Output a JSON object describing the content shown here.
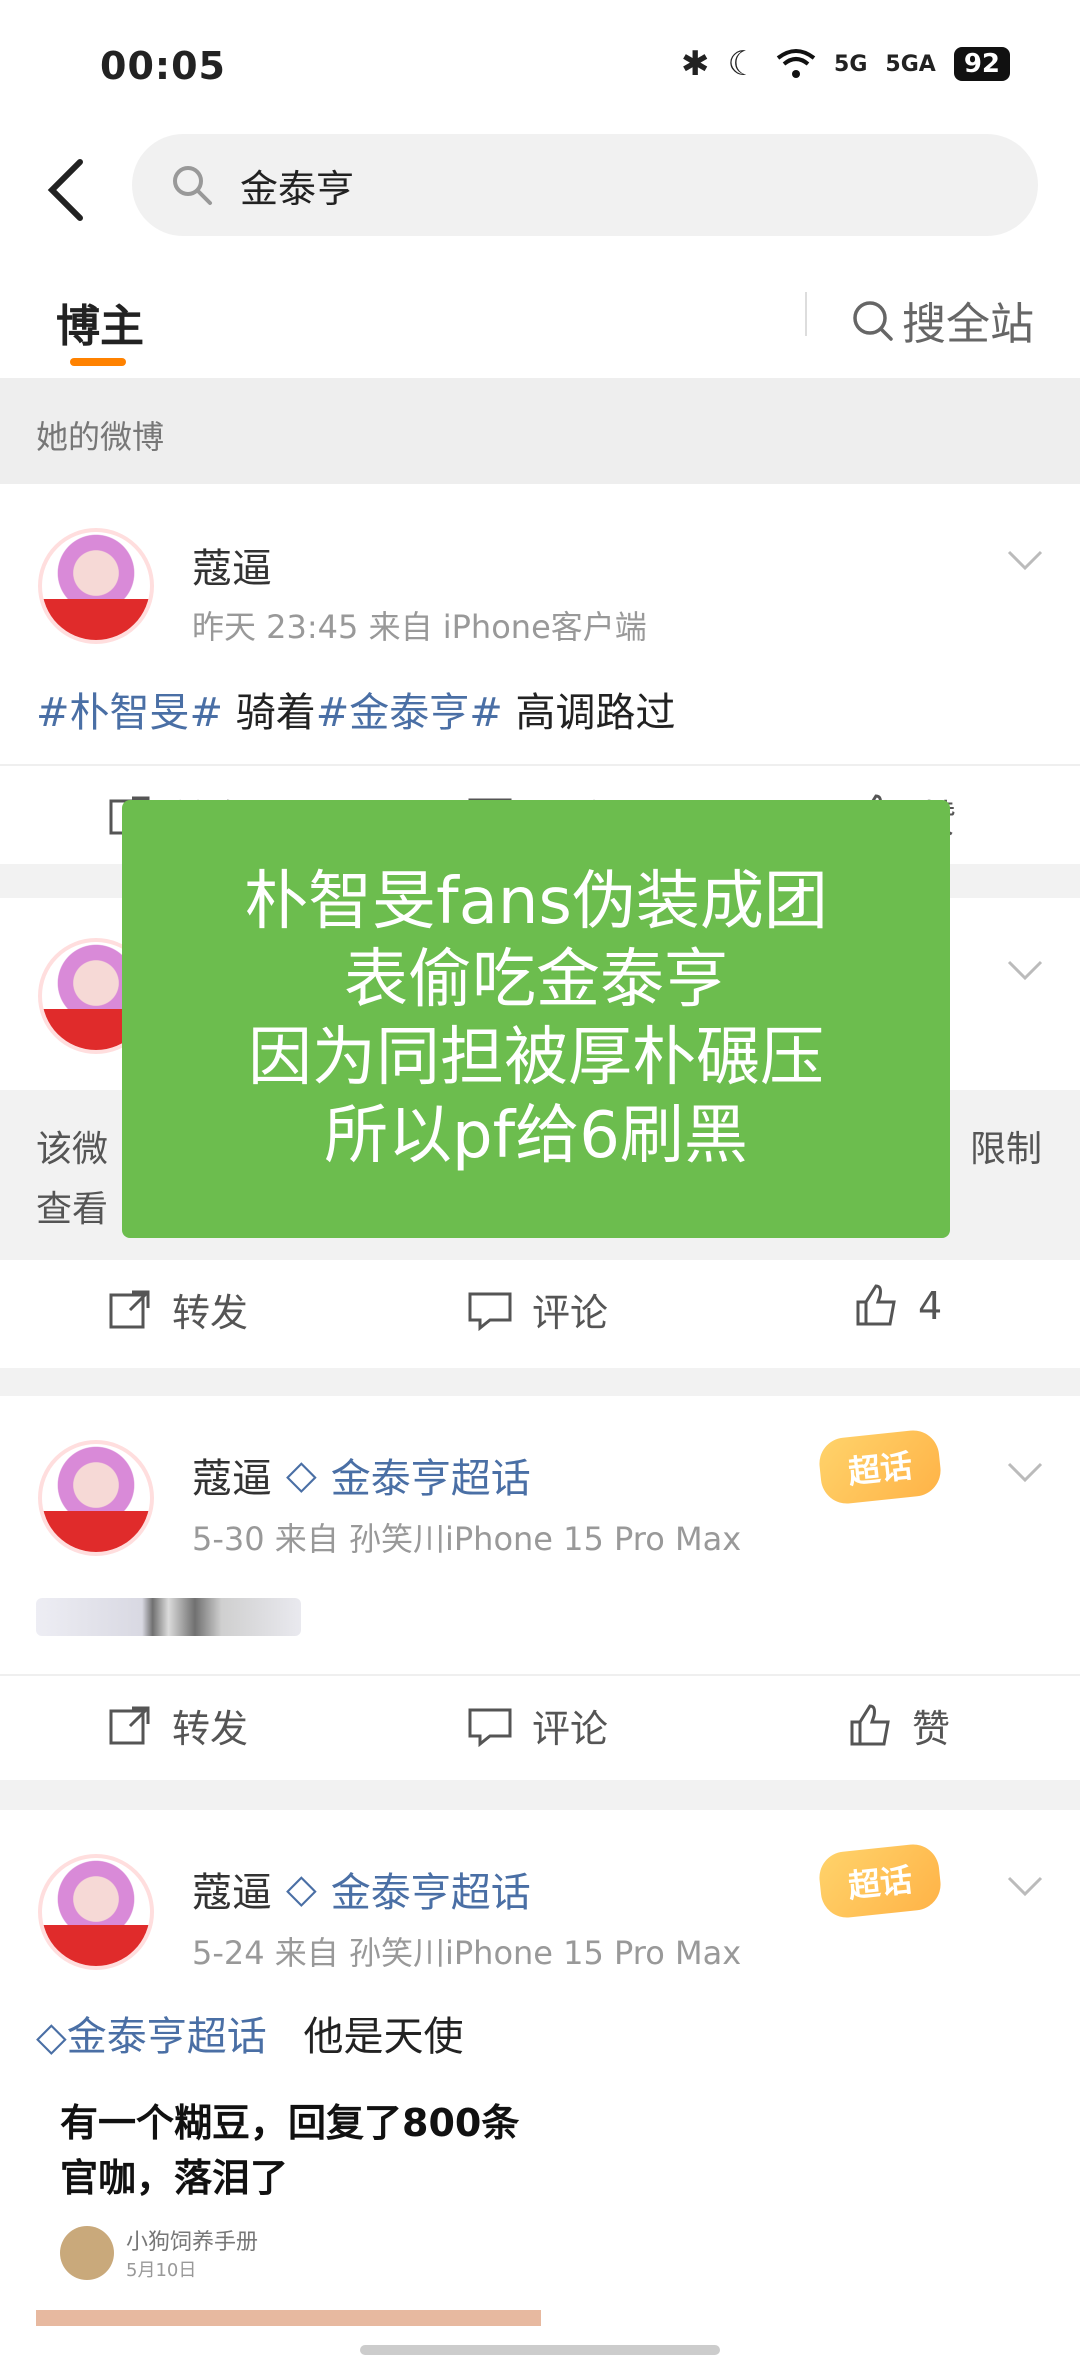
{
  "status": {
    "time": "00:05",
    "battery": "92",
    "net1": "5G",
    "net2": "5GA"
  },
  "search": {
    "query": "金泰亨"
  },
  "tabs": {
    "active": "博主",
    "right": "搜全站"
  },
  "section": {
    "title": "她的微博"
  },
  "post1": {
    "username": "蔻逼",
    "meta": "昨天 23:45  来自 iPhone客户端",
    "tag1": "#朴智旻#",
    "mid": " 骑着",
    "tag2": "#金泰亨#",
    "end": " 高调路过",
    "repost": "转发",
    "comment": "评论",
    "like": "赞"
  },
  "overlay": {
    "l1": "朴智旻fans伪装成团",
    "l2": "表偷吃金泰亨",
    "l3": "因为同担被厚朴碾压",
    "l4": "所以pf给6刷黑"
  },
  "post2": {
    "restricted_l1": "该微",
    "restricted_l2": "查看",
    "restricted_r1": "限制",
    "repost": "转发",
    "comment": "评论",
    "likes": "4"
  },
  "post3": {
    "username": "蔻逼",
    "topic": "金泰亨超话",
    "meta": "5-30  来自 孙笑川iPhone 15 Pro Max",
    "badge": "超话",
    "repost": "转发",
    "comment": "评论",
    "like": "赞"
  },
  "post4": {
    "username": "蔻逼",
    "topic": "金泰亨超话",
    "meta": "5-24  来自 孙笑川iPhone 15 Pro Max",
    "badge": "超话",
    "topic_tag": "金泰亨超话",
    "text": "他是天使",
    "embed_title": "有一个糊豆，回复了800条官咖，落泪了",
    "embed_author": "小狗饲养手册",
    "embed_date": "5月10日"
  },
  "colors": {
    "accent": "#ff8200",
    "link": "#4a6fa5",
    "overlay": "#6cbd4e"
  }
}
